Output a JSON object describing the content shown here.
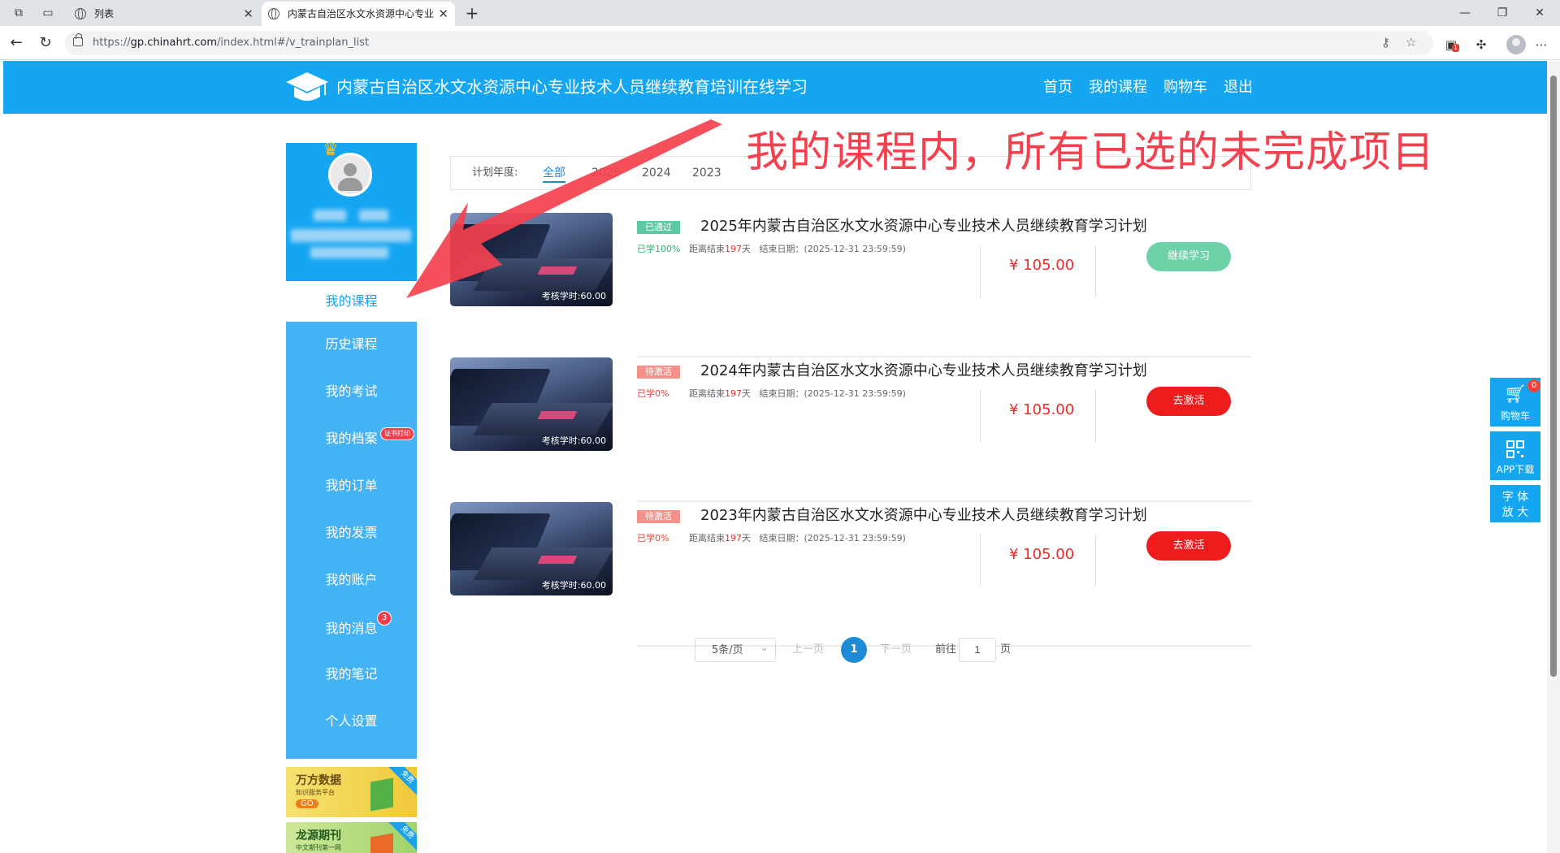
{
  "browser": {
    "tabs": [
      {
        "title": "列表",
        "active": false
      },
      {
        "title": "内蒙古自治区水文水资源中心专业",
        "active": true
      }
    ],
    "url_prefix": "https://",
    "url_host": "gp.chinahrt.com",
    "url_path": "/index.html#/v_trainplan_list",
    "extension_badge": "1"
  },
  "header": {
    "site_title": "内蒙古自治区水文水资源中心专业技术人员继续教育培训在线学习",
    "nav": [
      "首页",
      "我的课程",
      "购物车",
      "退出"
    ]
  },
  "sidebar": {
    "active_item": "我的课程",
    "items": [
      {
        "label": "历史课程"
      },
      {
        "label": "我的考试"
      },
      {
        "label": "我的档案",
        "badge": "证书打印"
      },
      {
        "label": "我的订单"
      },
      {
        "label": "我的发票"
      },
      {
        "label": "我的账户"
      },
      {
        "label": "我的消息",
        "badge": "3"
      },
      {
        "label": "我的笔记"
      },
      {
        "label": "个人设置"
      }
    ],
    "ads": [
      {
        "title": "万方数据",
        "subtitle": "知识服务平台",
        "cta": "GO",
        "ribbon": "免费"
      },
      {
        "title": "龙源期刊",
        "subtitle": "中文期刊第一网",
        "ribbon": "免费"
      }
    ]
  },
  "filter": {
    "label": "计划年度:",
    "options": [
      "全部",
      "2025",
      "2024",
      "2023"
    ],
    "selected": "全部"
  },
  "courses": [
    {
      "status": "已通过",
      "title": "2025年内蒙古自治区水文水资源中心专业技术人员继续教育学习计划",
      "progress": "已学100%",
      "remain_prefix": "距离结束",
      "remain_days": "197",
      "remain_suffix": "天",
      "end_date": "结束日期：(2025-12-31 23:59:59)",
      "hours": "考核学时:60.00",
      "price": "¥ 105.00",
      "action": "继续学习"
    },
    {
      "status": "待激活",
      "title": "2024年内蒙古自治区水文水资源中心专业技术人员继续教育学习计划",
      "progress": "已学0%",
      "remain_prefix": "距离结束",
      "remain_days": "197",
      "remain_suffix": "天",
      "end_date": "结束日期：(2025-12-31 23:59:59)",
      "hours": "考核学时:60.00",
      "price": "¥ 105.00",
      "action": "去激活"
    },
    {
      "status": "待激活",
      "title": "2023年内蒙古自治区水文水资源中心专业技术人员继续教育学习计划",
      "progress": "已学0%",
      "remain_prefix": "距离结束",
      "remain_days": "197",
      "remain_suffix": "天",
      "end_date": "结束日期：(2025-12-31 23:59:59)",
      "hours": "考核学时:60.00",
      "price": "¥ 105.00",
      "action": "去激活"
    }
  ],
  "pagination": {
    "page_size": "5条/页",
    "prev": "上一页",
    "current": "1",
    "next": "下一页",
    "goto_label": "前往",
    "goto_value": "1",
    "goto_suffix": "页"
  },
  "annotation": {
    "text": "我的课程内，所有已选的未完成项目",
    "color": "#f5414f"
  },
  "float_tools": {
    "cart_label": "购物车",
    "cart_count": "0",
    "app_label": "APP下载",
    "font_label_1": "字 体",
    "font_label_2": "放 大"
  },
  "colors": {
    "brand": "#15a6f2",
    "menu": "#44b3f5",
    "pass": "#5dc9a2",
    "pending": "#f3918a",
    "activate_button": "#ee1c1c",
    "continue_button": "#6dd2a8",
    "price": "#ef2a28"
  }
}
